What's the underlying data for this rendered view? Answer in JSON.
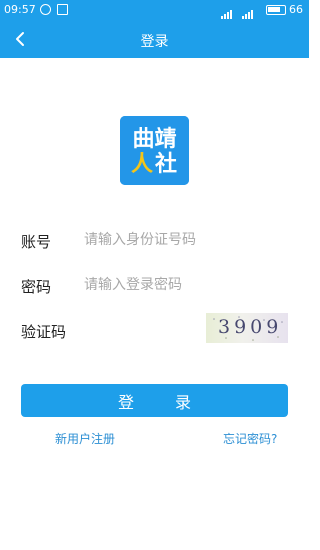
{
  "status_bar": {
    "time": "09:57",
    "battery_level": "66"
  },
  "app_bar": {
    "title": "登录"
  },
  "logo": {
    "line1": "曲靖",
    "line2_mark": "人",
    "line2_text": "社"
  },
  "form": {
    "account_label": "账号",
    "account_placeholder": "请输入身份证号码",
    "password_label": "密码",
    "password_placeholder": "请输入登录密码",
    "captcha_label": "验证码",
    "captcha_code": "3909"
  },
  "login_button": "登 录",
  "links": {
    "register": "新用户注册",
    "forgot": "忘记密码?"
  },
  "colors": {
    "primary": "#1E9FEA",
    "link": "#2C8FD4",
    "logo_accent": "#F5C518"
  }
}
